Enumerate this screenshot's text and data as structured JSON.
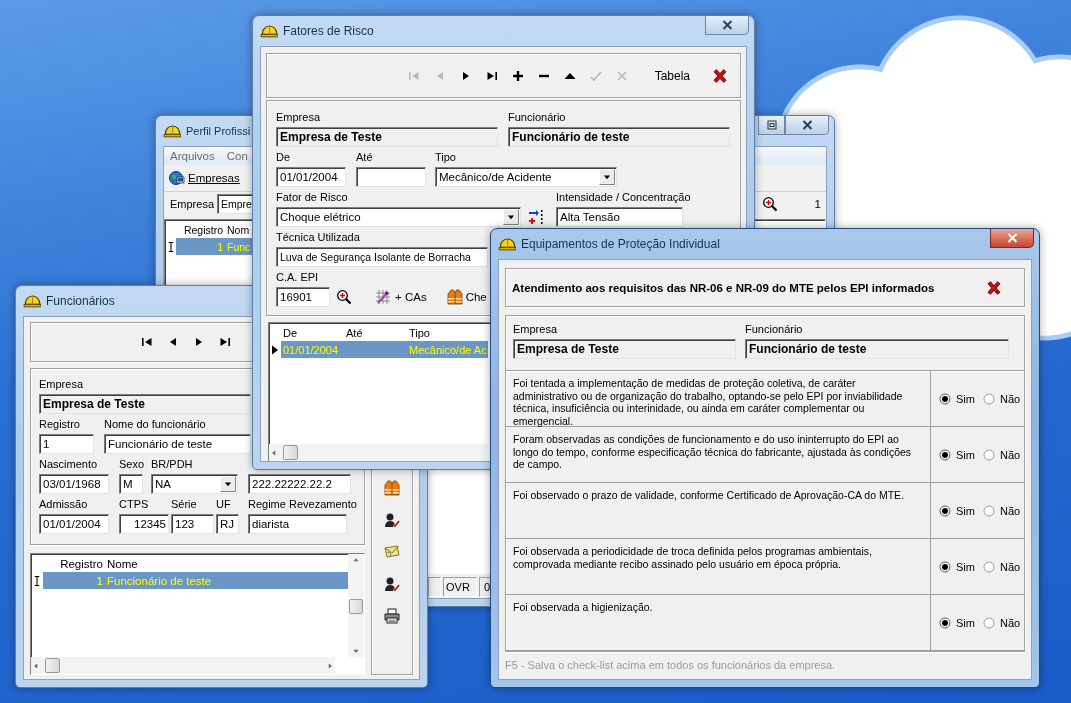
{
  "fatores_window": {
    "title": "Fatores de Risco",
    "active": false,
    "toolbar": {
      "buttons": [
        {
          "kind": "first",
          "disabled": true
        },
        {
          "kind": "prev",
          "disabled": true
        },
        {
          "kind": "next",
          "disabled": false
        },
        {
          "kind": "last",
          "disabled": false
        },
        {
          "kind": "add",
          "disabled": false
        },
        {
          "kind": "remove",
          "disabled": false
        },
        {
          "kind": "up",
          "disabled": false
        },
        {
          "kind": "check",
          "disabled": true
        },
        {
          "kind": "cancel",
          "disabled": true
        }
      ],
      "table_button": "Tabela"
    },
    "empresa": {
      "label": "Empresa",
      "value": "Empresa de Teste"
    },
    "funcionario": {
      "label": "Funcionário",
      "value": "Funcionário de teste"
    },
    "de": {
      "label": "De",
      "value": "01/01/2004"
    },
    "ate": {
      "label": "Até"
    },
    "tipo": {
      "label": "Tipo",
      "value": "Mecânico/de Acidente"
    },
    "fator_de_risco": {
      "label": "Fator de Risco",
      "value": "Choque elétrico"
    },
    "intensidade": {
      "label": "Intensidade / Concentração",
      "value": "Alta Tensão"
    },
    "tecnica": {
      "label": "Técnica Utilizada",
      "value": "Luva de Segurança Isolante de Borracha"
    },
    "ca_epi": {
      "label": "C.A. EPI",
      "value": "16901"
    },
    "cas_button": "+ CAs",
    "checklist_button": "Che",
    "grid": {
      "columns": [
        "De",
        "Até",
        "Tipo"
      ],
      "rows": [
        {
          "de": "01/01/2004",
          "tipo": "Mecânico/de Ac",
          "selected": true
        }
      ]
    }
  },
  "perfil_window": {
    "title": "Perfil Profissi",
    "active": false,
    "menu": [
      "Arquivos",
      "Con"
    ],
    "toolbar_button": "Empresas",
    "empresa": {
      "label": "Empresa",
      "value": "Empre"
    },
    "record_count": "1",
    "grid": {
      "columns": [
        "Registro",
        "Nom"
      ],
      "rows": [
        {
          "registro": "1",
          "nome": "Func",
          "selected": true
        }
      ]
    },
    "status_bar": [
      "OVR",
      "0"
    ]
  },
  "funcionarios_window": {
    "title": "Funcionários",
    "active": false,
    "nav_buttons": [
      {
        "kind": "first"
      },
      {
        "kind": "prev"
      },
      {
        "kind": "next"
      },
      {
        "kind": "last"
      }
    ],
    "empresa": {
      "label": "Empresa",
      "value": "Empresa de Teste"
    },
    "registro": {
      "label": "Registro",
      "value": "1"
    },
    "nome": {
      "label": "Nome do funcionário",
      "value": "Funcionário de teste"
    },
    "nascimento": {
      "label": "Nascimento",
      "value": "03/01/1968"
    },
    "sexo": {
      "label": "Sexo",
      "value": "M"
    },
    "br_pdh": {
      "label": "BR/PDH",
      "value": "NA"
    },
    "field_4": {
      "value": "222.22222.22.2"
    },
    "admissao": {
      "label": "Admissão",
      "value": "01/01/2004"
    },
    "ctps": {
      "label": "CTPS",
      "value": "12345"
    },
    "serie": {
      "label": "Série",
      "value": "123"
    },
    "uf": {
      "label": "UF",
      "value": "RJ"
    },
    "regime": {
      "label": "Regime Revezamento",
      "value": "diarista"
    },
    "grid": {
      "columns": [
        "Registro",
        "Nome"
      ],
      "rows": [
        {
          "registro": "1",
          "nome": "Funcionário de teste",
          "selected": true
        }
      ]
    }
  },
  "epi_window": {
    "title": "Equipamentos de Proteção Individual",
    "active": true,
    "heading": "Atendimento aos requisitos das NR-06 e NR-09 do MTE pelos EPI informados",
    "empresa": {
      "label": "Empresa",
      "value": "Empresa de Teste"
    },
    "funcionario": {
      "label": "Funcionário",
      "value": "Funcionário de teste"
    },
    "questions": [
      {
        "text": "Foi tentada a implementação de medidas de proteção coletiva, de caráter administrativo ou de organização do trabalho, optando-se pelo EPI por inviabilidade técnica, insuficiência ou interinidade, ou ainda em caráter complementar ou emergencial.",
        "options": [
          {
            "label": "Sim",
            "selected": true
          },
          {
            "label": "Não",
            "selected": false
          }
        ]
      },
      {
        "text": "Foram observadas as condições de funcionamento e do uso ininterrupto do EPI ao longo do tempo, conforme especificação técnica do fabricante, ajustada às condições de campo.",
        "options": [
          {
            "label": "Sim",
            "selected": true
          },
          {
            "label": "Não",
            "selected": false
          }
        ]
      },
      {
        "text": "Foi observado o prazo de validade, conforme Certificado de Aprovação-CA do MTE.",
        "options": [
          {
            "label": "Sim",
            "selected": true
          },
          {
            "label": "Não",
            "selected": false
          }
        ]
      },
      {
        "text": "Foi observada a periodicidade de troca definida pelos programas ambientais, comprovada mediante recibo assinado pelo usuário em época própria.",
        "options": [
          {
            "label": "Sim",
            "selected": true
          },
          {
            "label": "Não",
            "selected": false
          }
        ]
      },
      {
        "text": "Foi observada a higienização.",
        "options": [
          {
            "label": "Sim",
            "selected": true
          },
          {
            "label": "Não",
            "selected": false
          }
        ]
      }
    ],
    "footer": "F5 - Salva o check-list acima em todos os funcionários da empresa."
  }
}
